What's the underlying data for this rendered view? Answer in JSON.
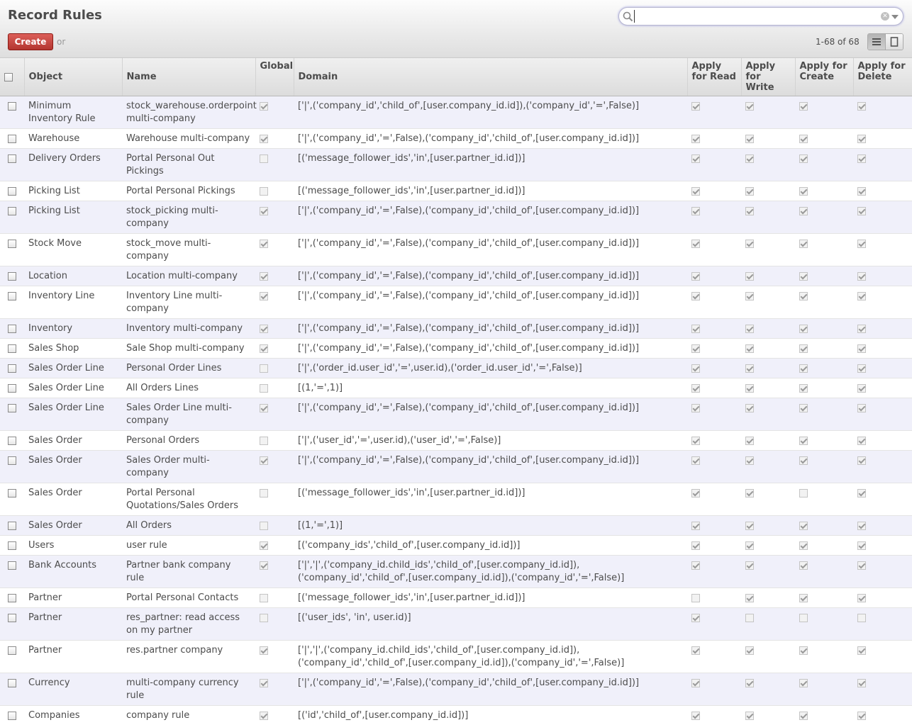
{
  "header": {
    "title": "Record Rules",
    "create_label": "Create",
    "or_label": "or",
    "pager": "1-68 of 68",
    "search_value": "",
    "clear_glyph": "✕"
  },
  "table": {
    "columns": {
      "object": "Object",
      "name": "Name",
      "global": "Global",
      "domain": "Domain",
      "read": "Apply for Read",
      "write": "Apply for Write",
      "create": "Apply for Create",
      "delete": "Apply for Delete"
    },
    "rows": [
      {
        "object": "Minimum Inventory Rule",
        "name": "stock_warehouse.orderpoint multi-company",
        "global": true,
        "domain": "['|',('company_id','child_of',[user.company_id.id]),('company_id','=',False)]",
        "read": true,
        "write": true,
        "create": true,
        "delete": true
      },
      {
        "object": "Warehouse",
        "name": "Warehouse multi-company",
        "global": true,
        "domain": "['|',('company_id','=',False),('company_id','child_of',[user.company_id.id])]",
        "read": true,
        "write": true,
        "create": true,
        "delete": true
      },
      {
        "object": "Delivery Orders",
        "name": "Portal Personal Out Pickings",
        "global": false,
        "domain": "[('message_follower_ids','in',[user.partner_id.id])]",
        "read": true,
        "write": true,
        "create": true,
        "delete": true
      },
      {
        "object": "Picking List",
        "name": "Portal Personal Pickings",
        "global": false,
        "domain": "[('message_follower_ids','in',[user.partner_id.id])]",
        "read": true,
        "write": true,
        "create": true,
        "delete": true
      },
      {
        "object": "Picking List",
        "name": "stock_picking multi-company",
        "global": true,
        "domain": "['|',('company_id','=',False),('company_id','child_of',[user.company_id.id])]",
        "read": true,
        "write": true,
        "create": true,
        "delete": true
      },
      {
        "object": "Stock Move",
        "name": "stock_move multi-company",
        "global": true,
        "domain": "['|',('company_id','=',False),('company_id','child_of',[user.company_id.id])]",
        "read": true,
        "write": true,
        "create": true,
        "delete": true
      },
      {
        "object": "Location",
        "name": "Location multi-company",
        "global": true,
        "domain": "['|',('company_id','=',False),('company_id','child_of',[user.company_id.id])]",
        "read": true,
        "write": true,
        "create": true,
        "delete": true
      },
      {
        "object": "Inventory Line",
        "name": "Inventory Line multi-company",
        "global": true,
        "domain": "['|',('company_id','=',False),('company_id','child_of',[user.company_id.id])]",
        "read": true,
        "write": true,
        "create": true,
        "delete": true
      },
      {
        "object": "Inventory",
        "name": "Inventory multi-company",
        "global": true,
        "domain": "['|',('company_id','=',False),('company_id','child_of',[user.company_id.id])]",
        "read": true,
        "write": true,
        "create": true,
        "delete": true
      },
      {
        "object": "Sales Shop",
        "name": "Sale Shop multi-company",
        "global": true,
        "domain": "['|',('company_id','=',False),('company_id','child_of',[user.company_id.id])]",
        "read": true,
        "write": true,
        "create": true,
        "delete": true
      },
      {
        "object": "Sales Order Line",
        "name": "Personal Order Lines",
        "global": false,
        "domain": "['|',('order_id.user_id','=',user.id),('order_id.user_id','=',False)]",
        "read": true,
        "write": true,
        "create": true,
        "delete": true
      },
      {
        "object": "Sales Order Line",
        "name": "All Orders Lines",
        "global": false,
        "domain": "[(1,'=',1)]",
        "read": true,
        "write": true,
        "create": true,
        "delete": true
      },
      {
        "object": "Sales Order Line",
        "name": "Sales Order Line multi-company",
        "global": true,
        "domain": "['|',('company_id','=',False),('company_id','child_of',[user.company_id.id])]",
        "read": true,
        "write": true,
        "create": true,
        "delete": true
      },
      {
        "object": "Sales Order",
        "name": "Personal Orders",
        "global": false,
        "domain": "['|',('user_id','=',user.id),('user_id','=',False)]",
        "read": true,
        "write": true,
        "create": true,
        "delete": true
      },
      {
        "object": "Sales Order",
        "name": "Sales Order multi-company",
        "global": true,
        "domain": "['|',('company_id','=',False),('company_id','child_of',[user.company_id.id])]",
        "read": true,
        "write": true,
        "create": true,
        "delete": true
      },
      {
        "object": "Sales Order",
        "name": "Portal Personal Quotations/Sales Orders",
        "global": false,
        "domain": "[('message_follower_ids','in',[user.partner_id.id])]",
        "read": true,
        "write": true,
        "create": false,
        "delete": true
      },
      {
        "object": "Sales Order",
        "name": "All Orders",
        "global": false,
        "domain": "[(1,'=',1)]",
        "read": true,
        "write": true,
        "create": true,
        "delete": true
      },
      {
        "object": "Users",
        "name": "user rule",
        "global": true,
        "domain": "[('company_ids','child_of',[user.company_id.id])]",
        "read": true,
        "write": true,
        "create": true,
        "delete": true
      },
      {
        "object": "Bank Accounts",
        "name": "Partner bank company rule",
        "global": true,
        "domain": "['|','|',('company_id.child_ids','child_of',[user.company_id.id]),('company_id','child_of',[user.company_id.id]),('company_id','=',False)]",
        "read": true,
        "write": true,
        "create": true,
        "delete": true
      },
      {
        "object": "Partner",
        "name": "Portal Personal Contacts",
        "global": false,
        "domain": "[('message_follower_ids','in',[user.partner_id.id])]",
        "read": false,
        "write": true,
        "create": true,
        "delete": true
      },
      {
        "object": "Partner",
        "name": "res_partner: read access on my partner",
        "global": false,
        "domain": "[('user_ids', 'in', user.id)]",
        "read": true,
        "write": false,
        "create": false,
        "delete": false
      },
      {
        "object": "Partner",
        "name": "res.partner company",
        "global": true,
        "domain": "['|','|',('company_id.child_ids','child_of',[user.company_id.id]),('company_id','child_of',[user.company_id.id]),('company_id','=',False)]",
        "read": true,
        "write": true,
        "create": true,
        "delete": true
      },
      {
        "object": "Currency",
        "name": "multi-company currency rule",
        "global": true,
        "domain": "['|',('company_id','=',False),('company_id','child_of',[user.company_id.id])]",
        "read": true,
        "write": true,
        "create": true,
        "delete": true
      },
      {
        "object": "Companies",
        "name": "company rule",
        "global": true,
        "domain": "[('id','child_of',[user.company_id.id])]",
        "read": true,
        "write": true,
        "create": true,
        "delete": true
      }
    ]
  }
}
